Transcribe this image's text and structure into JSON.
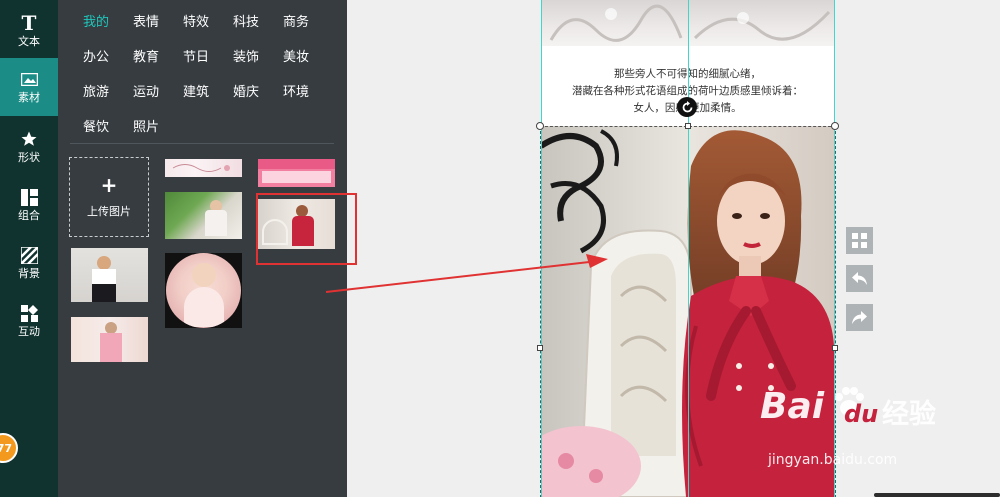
{
  "sidebar": {
    "items": [
      {
        "label": "文本",
        "icon": "text-icon"
      },
      {
        "label": "素材",
        "icon": "image-icon"
      },
      {
        "label": "形状",
        "icon": "star-icon"
      },
      {
        "label": "组合",
        "icon": "layout-icon"
      },
      {
        "label": "背景",
        "icon": "background-icon"
      },
      {
        "label": "互动",
        "icon": "interact-icon"
      }
    ],
    "active_index": 1,
    "badge": "77"
  },
  "materials": {
    "categories": [
      [
        "我的",
        "表情",
        "特效",
        "科技",
        "商务"
      ],
      [
        "办公",
        "教育",
        "节日",
        "装饰",
        "美妆"
      ],
      [
        "旅游",
        "运动",
        "建筑",
        "婚庆",
        "环境"
      ],
      [
        "餐饮",
        "照片"
      ]
    ],
    "active_category": "我的",
    "upload_label": "上传图片",
    "upload_plus": "+"
  },
  "canvas": {
    "caption_lines": [
      "那些旁人不可得知的细腻心绪，",
      "潜藏在各种形式花语组成的荷叶边质感里倾诉着：",
      "女人，因感 更加柔情。"
    ],
    "rotate_icon": "rotate-icon"
  },
  "toolbar": {
    "items": [
      "grid-icon",
      "undo-icon",
      "redo-icon"
    ]
  },
  "watermark": {
    "brand": "Bai",
    "brand_tail": "du",
    "cn": "经验",
    "url": "jingyan.baidu.com"
  },
  "colors": {
    "rail_bg": "#10332f",
    "rail_active": "#1c8d86",
    "panel_bg": "#363c40",
    "accent": "#1ec8bd",
    "highlight": "#e03232",
    "guide": "#3ed6cd"
  }
}
